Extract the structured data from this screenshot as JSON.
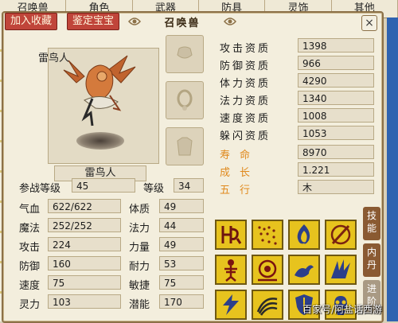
{
  "background_tabs": [
    "召唤兽",
    "角色",
    "武器",
    "防具",
    "灵饰",
    "其他"
  ],
  "dialog": {
    "title": "召唤兽",
    "close_label": "×",
    "add_favorite_label": "加入收藏",
    "appraise_label": "鉴定宝宝"
  },
  "pet": {
    "name_top": "雷鸟人",
    "name": "雷鸟人"
  },
  "stats": {
    "join_level_label": "参战等级",
    "join_level": "45",
    "level_label": "等级",
    "level": "34",
    "hp_label": "气血",
    "hp": "622/622",
    "mp_label": "魔法",
    "mp": "252/252",
    "attack_label": "攻击",
    "attack": "224",
    "defense_label": "防御",
    "defense": "160",
    "speed_label": "速度",
    "speed": "75",
    "spirit_label": "灵力",
    "spirit": "103",
    "constitution_label": "体质",
    "constitution": "49",
    "magic_label": "法力",
    "magic": "44",
    "strength_label": "力量",
    "strength": "49",
    "endurance_label": "耐力",
    "endurance": "53",
    "agility_label": "敏捷",
    "agility": "75",
    "potential_label": "潜能",
    "potential": "170"
  },
  "aptitudes": [
    {
      "label": "攻击资质",
      "value": "1398"
    },
    {
      "label": "防御资质",
      "value": "966"
    },
    {
      "label": "体力资质",
      "value": "4290"
    },
    {
      "label": "法力资质",
      "value": "1340"
    },
    {
      "label": "速度资质",
      "value": "1008"
    },
    {
      "label": "躲闪资质",
      "value": "1053"
    }
  ],
  "life": {
    "label": "寿命",
    "value": "8970"
  },
  "growth": {
    "label": "成长",
    "value": "1.221"
  },
  "element": {
    "label": "五行",
    "value": "木"
  },
  "skills": [
    "rune-skill-icon",
    "thunder-skill-icon",
    "fire-skill-icon",
    "weapon-skill-icon",
    "skeleton-skill-icon",
    "shield-skill-icon",
    "dragon-skill-icon",
    "wing-skill-icon",
    "lightning-skill-icon",
    "wave-skill-icon",
    "defense-shield-skill-icon",
    "skull-skill-icon"
  ],
  "side_tabs": {
    "skills_label": "技能",
    "inner_label": "内丹",
    "advance_label": "进阶"
  },
  "watermark": "百家号/阿盐话西游",
  "colors": {
    "dialog_bg": "#f3eedd",
    "button_red": "#c0453a",
    "skill_gold": "#e7c31e",
    "orange_label": "#e08a1e",
    "tab_brown": "#8a5a32"
  }
}
